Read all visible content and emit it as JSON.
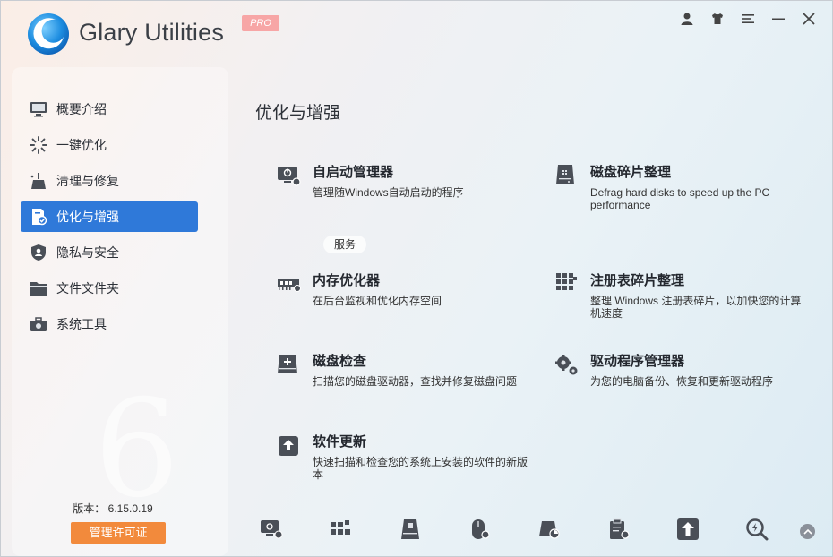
{
  "app": {
    "title": "Glary Utilities",
    "edition": "PRO",
    "accent": "#2f79d9",
    "license_color": "#f28a3c"
  },
  "window_controls": [
    "user-icon",
    "skin-icon",
    "menu-icon",
    "minimize-icon",
    "close-icon"
  ],
  "sidebar": {
    "items": [
      {
        "label": "概要介绍",
        "icon": "monitor-icon"
      },
      {
        "label": "一键优化",
        "icon": "spinner-icon"
      },
      {
        "label": "清理与修复",
        "icon": "broom-icon"
      },
      {
        "label": "优化与增强",
        "icon": "speed-doc-icon",
        "active": true
      },
      {
        "label": "隐私与安全",
        "icon": "shield-icon"
      },
      {
        "label": "文件文件夹",
        "icon": "folder-icon"
      },
      {
        "label": "系统工具",
        "icon": "toolbox-icon"
      }
    ],
    "version_label": "版本：",
    "version": "6.15.0.19",
    "license_button": "管理许可证"
  },
  "main": {
    "title": "优化与增强",
    "services_tag": "服务",
    "features": [
      {
        "title": "自启动管理器",
        "desc": "管理随Windows自动启动的程序",
        "icon": "startup-manager-icon"
      },
      {
        "title": "磁盘碎片整理",
        "desc": "Defrag hard disks to speed up the PC performance",
        "icon": "disk-defrag-icon"
      },
      {
        "title": "内存优化器",
        "desc": "在后台监视和优化内存空间",
        "icon": "memory-icon"
      },
      {
        "title": "注册表碎片整理",
        "desc": "整理 Windows 注册表碎片，以加快您的计算机速度",
        "icon": "registry-defrag-icon"
      },
      {
        "title": "磁盘检查",
        "desc": "扫描您的磁盘驱动器，查找并修复磁盘问题",
        "icon": "disk-check-icon"
      },
      {
        "title": "驱动程序管理器",
        "desc": "为您的电脑备份、恢复和更新驱动程序",
        "icon": "driver-gear-icon"
      },
      {
        "title": "软件更新",
        "desc": "快速扫描和检查您的系统上安装的软件的新版本",
        "icon": "software-update-icon"
      }
    ]
  },
  "toolbar": [
    "startup-manager-icon",
    "registry-blocks-icon",
    "disk-cleaner-icon",
    "mouse-settings-icon",
    "disk-analysis-icon",
    "clipboard-settings-icon",
    "upload-icon",
    "search-zoom-icon"
  ]
}
